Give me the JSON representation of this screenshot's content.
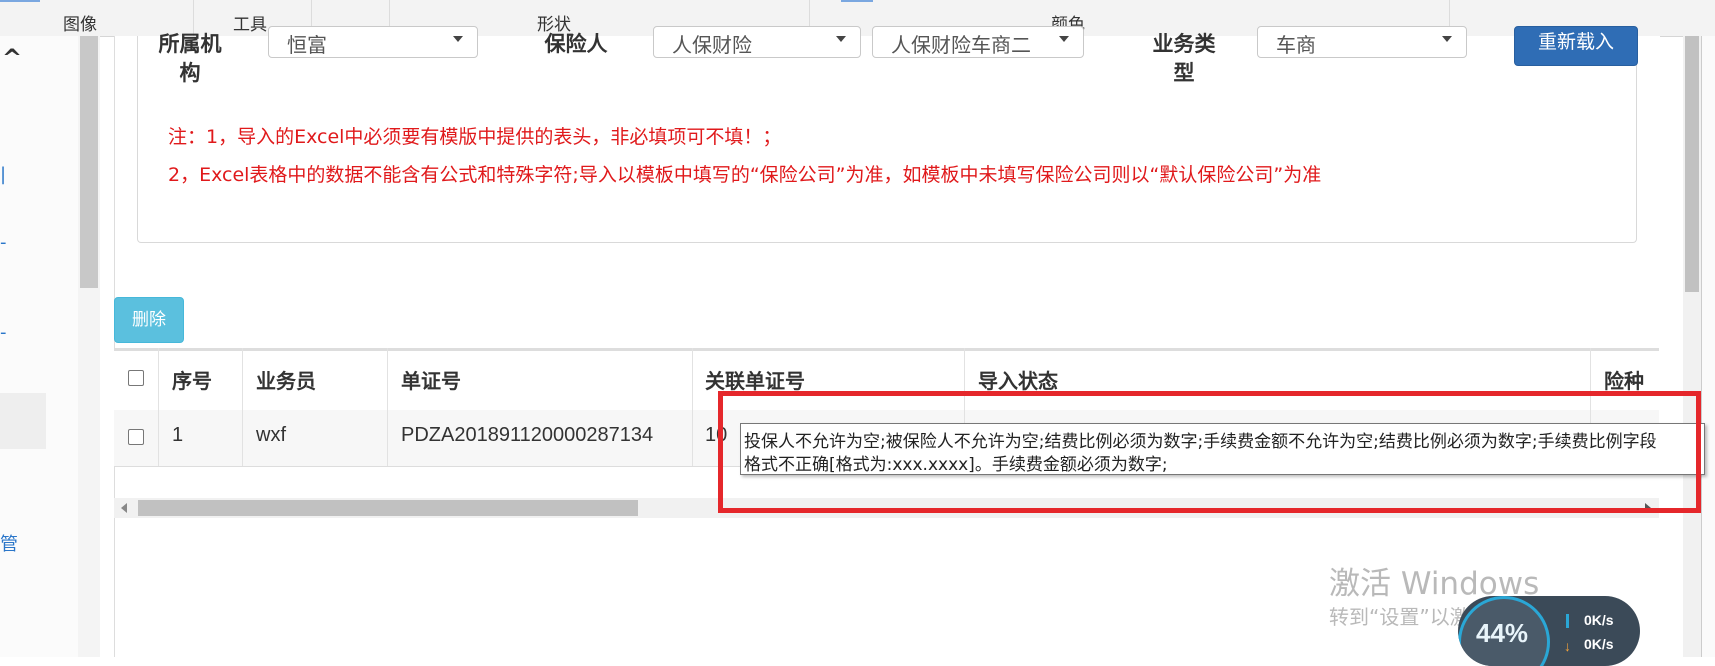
{
  "ribbon": {
    "groups": [
      "图像",
      "工具",
      "形状",
      "颜色"
    ]
  },
  "leftnav": {
    "items": [
      "^",
      "|",
      "-",
      "-",
      "管"
    ]
  },
  "filters": {
    "org_label": "所属机构",
    "org_value": "恒富",
    "insurer_label": "保险人",
    "insurer_value": "人保财险",
    "insurer_sub_value": "人保财险车商二",
    "biztype_label": "业务类型",
    "biztype_value": "车商",
    "reload_button": "重新载入"
  },
  "notes": {
    "line1": "注：1，导入的Excel中必须要有模版中提供的表头，非必填项可不填！；",
    "line2": "2，Excel表格中的数据不能含有公式和特殊字符;导入以模板中填写的“保险公司”为准，如模板中未填写保险公司则以“默认保险公司”为准"
  },
  "toolbar": {
    "delete_button": "删除"
  },
  "table": {
    "headers": [
      "序号",
      "业务员",
      "单证号",
      "关联单证号",
      "导入状态",
      "险种"
    ],
    "rows": [
      {
        "index": "1",
        "salesperson": "wxf",
        "doc_no": "PDZA201891120000287134",
        "related_doc_no": "10"
      }
    ]
  },
  "tooltip": {
    "line1": "投保人不允许为空;被保险人不允许为空;结费比例必须为数字;手续费金额不允许为空;结费比例必须为数字;手续费比例字段",
    "line2": "格式不正确[格式为:xxx.xxxx]。手续费金额必须为数字;"
  },
  "watermark": {
    "line1": "激活 Windows",
    "line2": "转到“设置”以激活 Windows。"
  },
  "speed_widget": {
    "percent": "44%",
    "up_rate": "0K/s",
    "down_rate": "0K/s"
  },
  "colors": {
    "note_red": "#e0191b",
    "primary_blue": "#2f6db5",
    "info_blue": "#5bc0de",
    "highlight_red": "#e5272b"
  }
}
